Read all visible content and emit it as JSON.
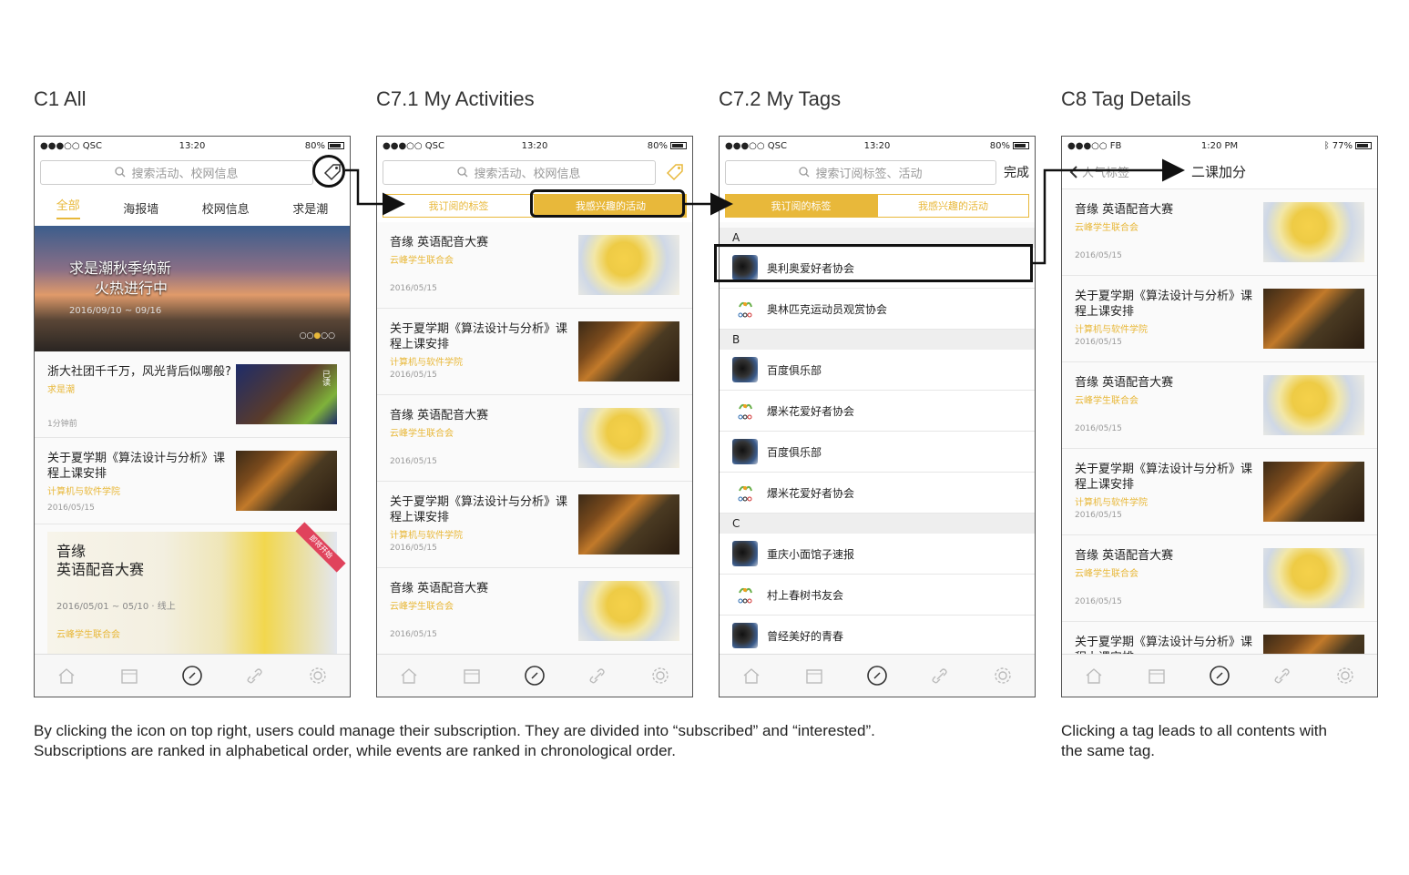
{
  "sections": {
    "c1": "C1 All",
    "c71": "C7.1 My Activities",
    "c72": "C7.2 My Tags",
    "c8": "C8 Tag Details"
  },
  "status": {
    "carrier1": "●●●○○ QSC",
    "carrier2": "●●●○○ FB",
    "time1": "13:20",
    "time2": "1:20 PM",
    "battery1": "80%",
    "battery2": "77%"
  },
  "c1": {
    "search_placeholder": "搜索活动、校网信息",
    "tabs": [
      "全部",
      "海报墙",
      "校网信息",
      "求是潮"
    ],
    "banner_line1": "求是潮秋季纳新",
    "banner_line2": "火热进行中",
    "banner_date": "2016/09/10 ~ 09/16",
    "items": [
      {
        "title": "浙大社团千千万，风光背后似哪般?",
        "source": "求是潮",
        "date": "1分钟前",
        "badge": "已读"
      },
      {
        "title": "关于夏学期《算法设计与分析》课程上课安排",
        "source": "计算机与软件学院",
        "date": "2016/05/15"
      }
    ],
    "event": {
      "line1": "音缘",
      "line2": "英语配音大赛",
      "date": "2016/05/01 ~ 05/10 · 线上",
      "org": "云峰学生联合会",
      "ribbon": "即将开始"
    }
  },
  "c71": {
    "search_placeholder": "搜索活动、校网信息",
    "seg": [
      "我订阅的标签",
      "我感兴趣的活动"
    ],
    "items": [
      {
        "title": "音缘 英语配音大赛",
        "source": "云峰学生联合会",
        "date": "2016/05/15",
        "img": "flower"
      },
      {
        "title": "关于夏学期《算法设计与分析》课程上课安排",
        "source": "计算机与软件学院",
        "date": "2016/05/15",
        "img": "painting"
      },
      {
        "title": "音缘 英语配音大赛",
        "source": "云峰学生联合会",
        "date": "2016/05/15",
        "img": "flower"
      },
      {
        "title": "关于夏学期《算法设计与分析》课程上课安排",
        "source": "计算机与软件学院",
        "date": "2016/05/15",
        "img": "painting"
      },
      {
        "title": "音缘 英语配音大赛",
        "source": "云峰学生联合会",
        "date": "2016/05/15",
        "img": "flower"
      }
    ]
  },
  "c72": {
    "search_placeholder": "搜索订阅标签、活动",
    "done": "完成",
    "seg": [
      "我订阅的标签",
      "我感兴趣的活动"
    ],
    "groups": [
      {
        "letter": "A",
        "tags": [
          {
            "name": "奥利奥爱好者协会",
            "logo": "a"
          },
          {
            "name": "奥林匹克运动员观赏协会",
            "logo": "b"
          }
        ]
      },
      {
        "letter": "B",
        "tags": [
          {
            "name": "百度俱乐部",
            "logo": "a"
          },
          {
            "name": "爆米花爱好者协会",
            "logo": "b"
          },
          {
            "name": "百度俱乐部",
            "logo": "a"
          },
          {
            "name": "爆米花爱好者协会",
            "logo": "b"
          }
        ]
      },
      {
        "letter": "C",
        "tags": [
          {
            "name": "重庆小面馆子速报",
            "logo": "a"
          },
          {
            "name": "村上春树书友会",
            "logo": "b"
          },
          {
            "name": "曾经美好的青春",
            "logo": "a"
          }
        ]
      }
    ]
  },
  "c8": {
    "back": "人气标签",
    "title": "二课加分",
    "items": [
      {
        "title": "音缘 英语配音大赛",
        "source": "云峰学生联合会",
        "date": "2016/05/15",
        "img": "flower"
      },
      {
        "title": "关于夏学期《算法设计与分析》课程上课安排",
        "source": "计算机与软件学院",
        "date": "2016/05/15",
        "img": "painting"
      },
      {
        "title": "音缘 英语配音大赛",
        "source": "云峰学生联合会",
        "date": "2016/05/15",
        "img": "flower"
      },
      {
        "title": "关于夏学期《算法设计与分析》课程上课安排",
        "source": "计算机与软件学院",
        "date": "2016/05/15",
        "img": "painting"
      },
      {
        "title": "音缘 英语配音大赛",
        "source": "云峰学生联合会",
        "date": "2016/05/15",
        "img": "flower"
      },
      {
        "title": "关于夏学期《算法设计与分析》课程上课安排",
        "source": "",
        "date": "",
        "img": "painting"
      }
    ]
  },
  "captions": {
    "left_1": "By clicking the icon on top right, users could manage their subscription. They are divided into “subscribed” and “interested”.",
    "left_2": "Subscriptions are ranked in alphabetical order, while events are ranked in chronological order.",
    "right_1": "Clicking a tag leads to all contents with",
    "right_2": "the same tag."
  },
  "colors": {
    "accent": "#e8b83a",
    "text": "#222222"
  },
  "tabbar_icons": [
    "home-icon",
    "calendar-icon",
    "compass-icon",
    "link-icon",
    "gear-icon"
  ]
}
